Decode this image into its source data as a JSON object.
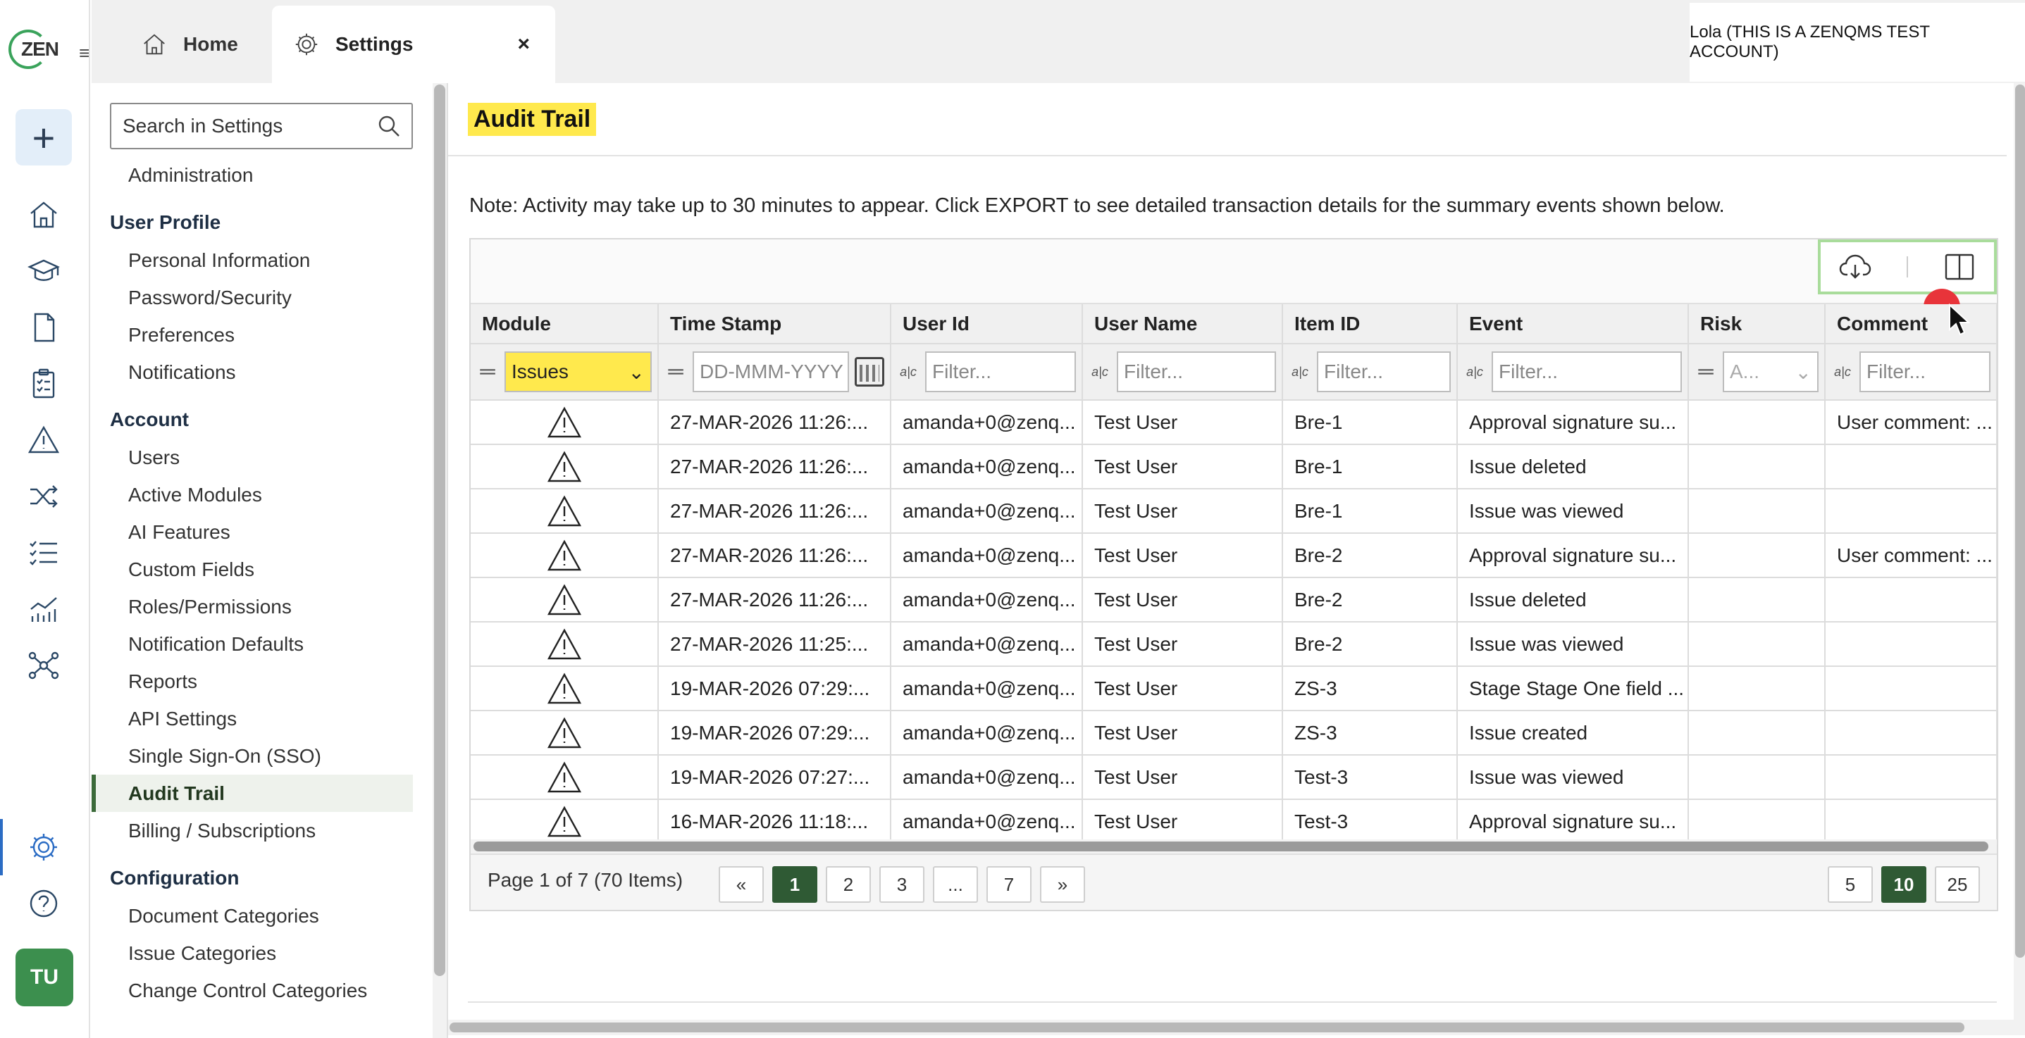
{
  "app": {
    "logo_text": "ZEN"
  },
  "rail": {
    "avatar_initials": "TU",
    "icons": [
      "plus-icon",
      "home-icon",
      "graduation-cap-icon",
      "document-icon",
      "clipboard-icon",
      "warning-icon",
      "shuffle-icon",
      "checklist-icon",
      "analytics-icon",
      "network-icon",
      "gear-icon",
      "help-icon"
    ]
  },
  "tabs": [
    {
      "label": "Home"
    },
    {
      "label": "Settings"
    }
  ],
  "tab_close": "×",
  "account": {
    "label": "Lola (THIS IS A ZENQMS TEST ACCOUNT)"
  },
  "sidebar": {
    "search_placeholder": "Search in Settings",
    "administration": "Administration",
    "sections": [
      {
        "title": "User Profile",
        "items": [
          "Personal Information",
          "Password/Security",
          "Preferences",
          "Notifications"
        ]
      },
      {
        "title": "Account",
        "items": [
          "Users",
          "Active Modules",
          "AI Features",
          "Custom Fields",
          "Roles/Permissions",
          "Notification Defaults",
          "Reports",
          "API Settings",
          "Single Sign-On (SSO)",
          "Audit Trail",
          "Billing / Subscriptions"
        ]
      },
      {
        "title": "Configuration",
        "items": [
          "Document Categories",
          "Issue Categories",
          "Change Control Categories"
        ]
      }
    ],
    "active_item": "Audit Trail"
  },
  "main": {
    "title": "Audit Trail",
    "note": "Note: Activity may take up to 30 minutes to appear. Click EXPORT to see detailed transaction details for the summary events shown below."
  },
  "grid": {
    "columns": [
      "Module",
      "Time Stamp",
      "User Id",
      "User Name",
      "Item ID",
      "Event",
      "Risk",
      "Comment"
    ],
    "filters": {
      "module_value": "Issues",
      "timestamp_placeholder": "DD-MMM-YYYY",
      "text_placeholder": "Filter...",
      "risk_placeholder": "A..."
    },
    "rows": [
      [
        "27-MAR-2026 11:26:...",
        "amanda+0@zenq...",
        "Test User",
        "Bre-1",
        "Approval signature su...",
        "",
        "User comment: ..."
      ],
      [
        "27-MAR-2026 11:26:...",
        "amanda+0@zenq...",
        "Test User",
        "Bre-1",
        "Issue deleted",
        "",
        ""
      ],
      [
        "27-MAR-2026 11:26:...",
        "amanda+0@zenq...",
        "Test User",
        "Bre-1",
        "Issue was viewed",
        "",
        ""
      ],
      [
        "27-MAR-2026 11:26:...",
        "amanda+0@zenq...",
        "Test User",
        "Bre-2",
        "Approval signature su...",
        "",
        "User comment: ..."
      ],
      [
        "27-MAR-2026 11:26:...",
        "amanda+0@zenq...",
        "Test User",
        "Bre-2",
        "Issue deleted",
        "",
        ""
      ],
      [
        "27-MAR-2026 11:25:...",
        "amanda+0@zenq...",
        "Test User",
        "Bre-2",
        "Issue was viewed",
        "",
        ""
      ],
      [
        "19-MAR-2026 07:29:...",
        "amanda+0@zenq...",
        "Test User",
        "ZS-3",
        "Stage Stage One field ...",
        "",
        ""
      ],
      [
        "19-MAR-2026 07:29:...",
        "amanda+0@zenq...",
        "Test User",
        "ZS-3",
        "Issue created",
        "",
        ""
      ],
      [
        "19-MAR-2026 07:27:...",
        "amanda+0@zenq...",
        "Test User",
        "Test-3",
        "Issue was viewed",
        "",
        ""
      ],
      [
        "16-MAR-2026 11:18:...",
        "amanda+0@zenq...",
        "Test User",
        "Test-3",
        "Approval signature su...",
        "",
        ""
      ]
    ],
    "pager": {
      "info": "Page 1 of 7 (70 Items)",
      "first": "«",
      "pages": [
        "1",
        "2",
        "3",
        "...",
        "7"
      ],
      "last": "»",
      "current": "1",
      "sizes": [
        "5",
        "10",
        "25"
      ],
      "current_size": "10"
    }
  },
  "colors": {
    "accent_green": "#2f5a34",
    "highlight_yellow": "#ffe94d",
    "toolbar_outline": "#a9dc9b"
  }
}
